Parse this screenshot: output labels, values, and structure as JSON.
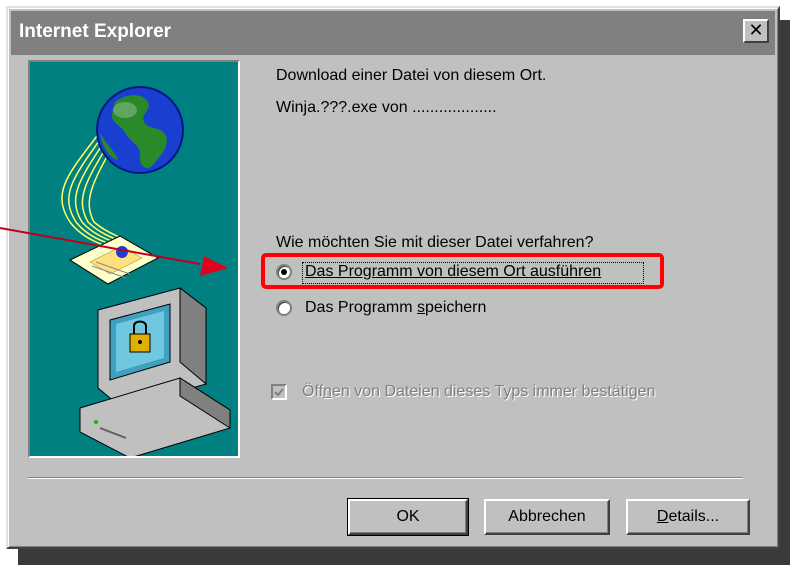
{
  "window": {
    "title": "Internet Explorer",
    "close_label": "✕"
  },
  "dialog": {
    "heading": "Download einer Datei von diesem Ort.",
    "file_line": "Winja.???.exe von ...................",
    "question": "Wie möchten Sie mit dieser Datei verfahren?",
    "options": [
      {
        "label": "Das Programm von diesem Ort ausführen",
        "selected": true
      },
      {
        "label_before": "Das Programm ",
        "label_access": "s",
        "label_after": "peichern",
        "selected": false
      }
    ],
    "confirm_checkbox": {
      "label_before": "Öff",
      "label_access": "n",
      "label_after": "en von Dateien dieses Typs immer bestätigen",
      "checked": true,
      "enabled": false
    }
  },
  "buttons": {
    "ok": "OK",
    "cancel": "Abbrechen",
    "details_access": "D",
    "details_rest": "etails..."
  },
  "colors": {
    "dialog_bg": "#c0c0c0",
    "titlebar_inactive": "#808080",
    "illustration_bg": "#008080",
    "annotation": "#ff0000"
  },
  "icons": [
    "globe-icon",
    "computer-lock-icon",
    "close-icon",
    "download-envelope-icon"
  ]
}
